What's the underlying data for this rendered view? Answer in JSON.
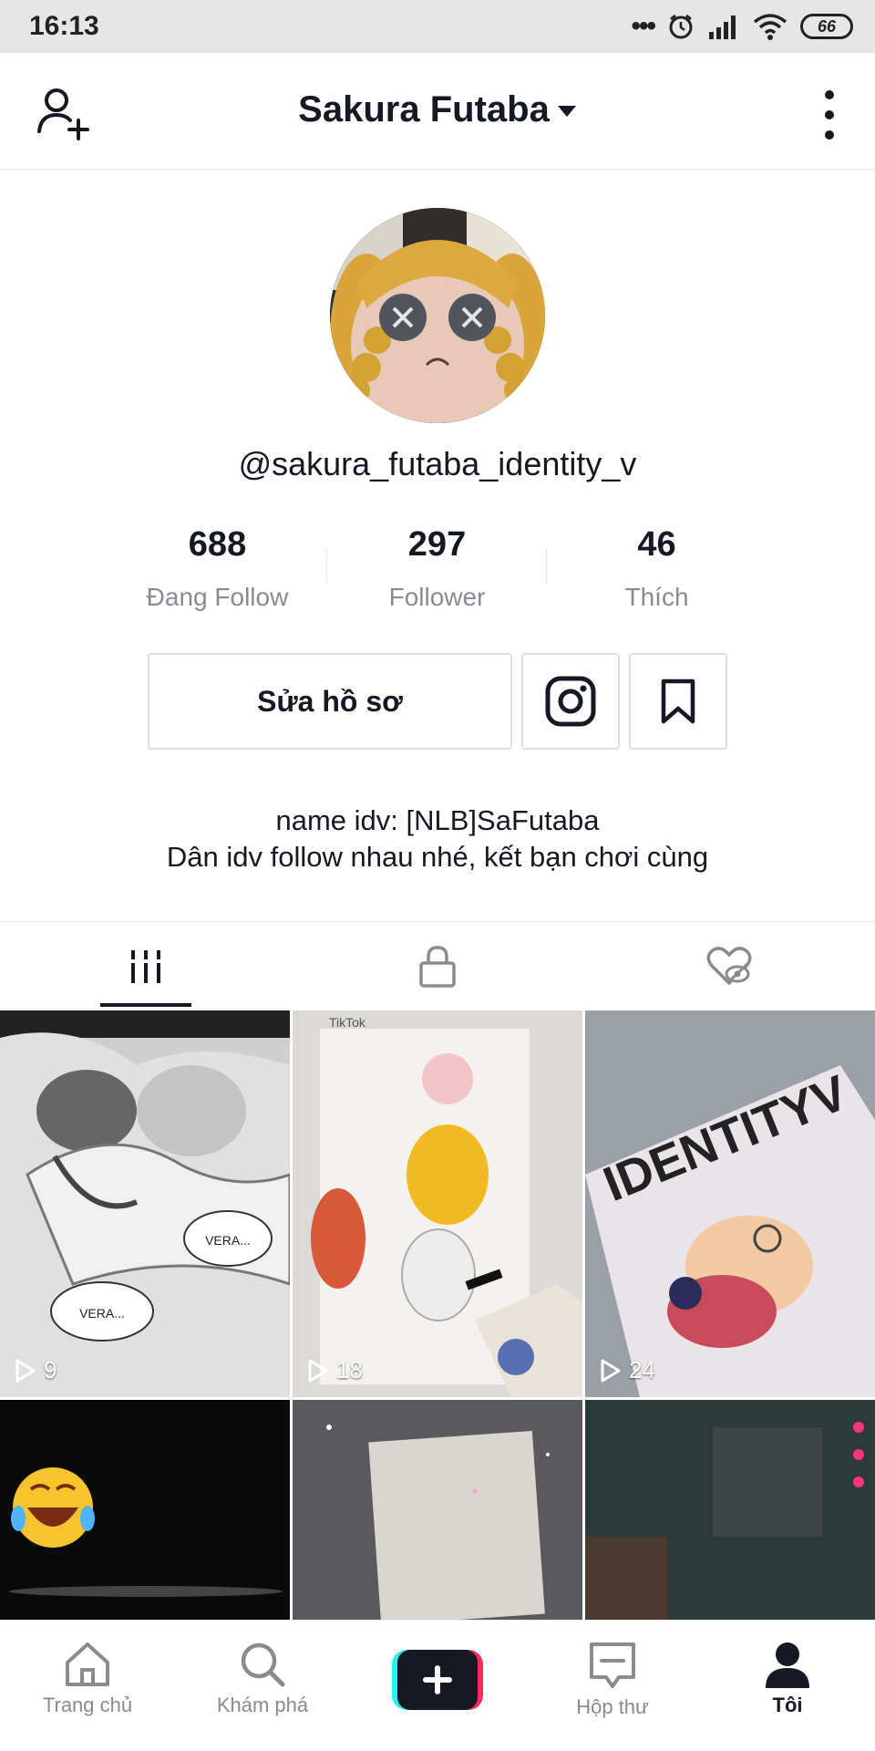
{
  "status_bar": {
    "time": "16:13",
    "battery": "66"
  },
  "header": {
    "title": "Sakura Futaba"
  },
  "profile": {
    "username": "@sakura_futaba_identity_v",
    "stats": [
      {
        "value": "688",
        "label": "Đang Follow"
      },
      {
        "value": "297",
        "label": "Follower"
      },
      {
        "value": "46",
        "label": "Thích"
      }
    ],
    "edit_button_label": "Sửa hồ sơ",
    "bio_line1": "name idv: [NLB]SaFutaba",
    "bio_line2": "Dân idv follow nhau nhé, kết bạn chơi cùng"
  },
  "videos": [
    {
      "views": "9",
      "caption": "VERA..."
    },
    {
      "views": "18",
      "caption": "TikTok"
    },
    {
      "views": "24",
      "caption": "IDENTITYV"
    },
    {
      "views": ""
    },
    {
      "views": ""
    },
    {
      "views": ""
    }
  ],
  "bottom_nav": {
    "items": [
      {
        "label": "Trang chủ",
        "icon": "home-icon"
      },
      {
        "label": "Khám phá",
        "icon": "search-icon"
      },
      {
        "label": "",
        "icon": "plus-icon"
      },
      {
        "label": "Hộp thư",
        "icon": "inbox-icon"
      },
      {
        "label": "Tôi",
        "icon": "profile-icon"
      }
    ]
  },
  "colors": {
    "accent_red": "#fe2c55",
    "accent_cyan": "#25f4ee",
    "text_primary": "#161823",
    "text_secondary": "#8a8b91"
  }
}
